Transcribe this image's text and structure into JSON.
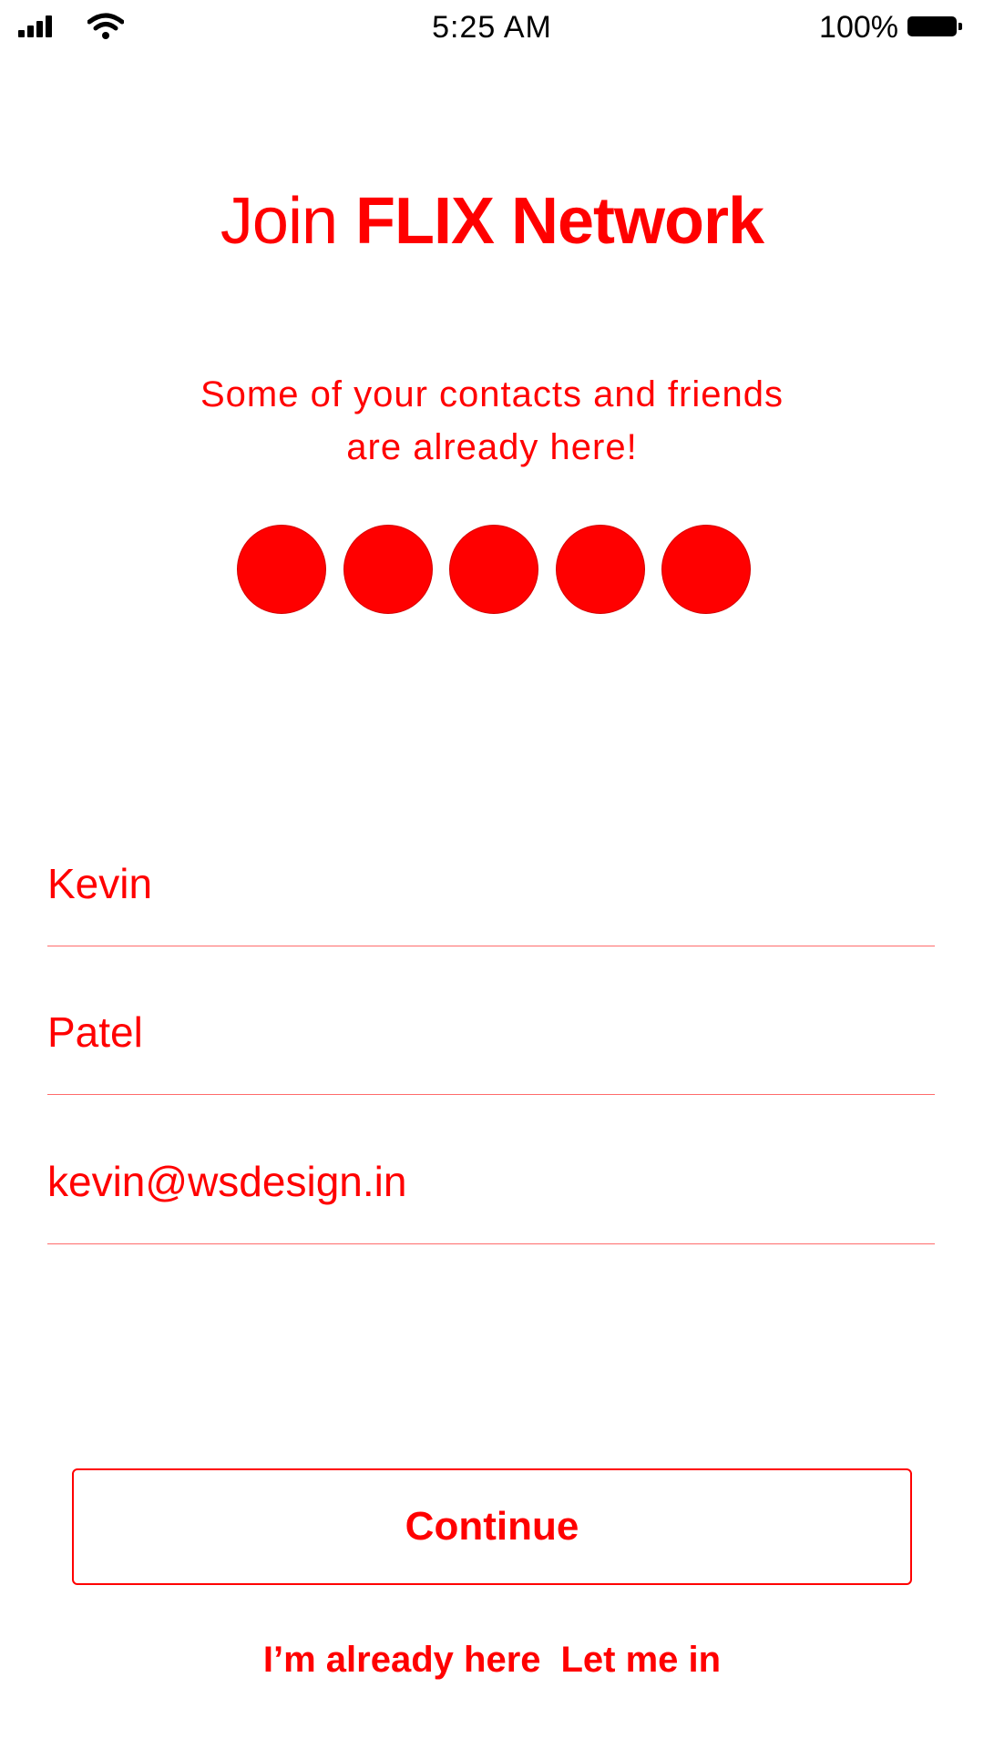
{
  "status_bar": {
    "time": "5:25 AM",
    "battery_percent": "100%",
    "signal_icon": "signal-bars-icon",
    "wifi_icon": "wifi-icon",
    "battery_icon": "battery-full-icon"
  },
  "header": {
    "title_light": "Join",
    "title_bold": "FLIX Network"
  },
  "subtitle": {
    "line1": "Some of your contacts and friends",
    "line2": "are already here!"
  },
  "avatars": {
    "count": 5,
    "color": "#ff0000"
  },
  "form": {
    "first_name": "Kevin",
    "last_name": "Patel",
    "email": "kevin@wsdesign.in"
  },
  "actions": {
    "continue_label": "Continue",
    "already_here_label": "I’m already here",
    "let_me_in_label": "Let me in"
  },
  "colors": {
    "accent": "#ff0000",
    "background": "#ffffff"
  }
}
